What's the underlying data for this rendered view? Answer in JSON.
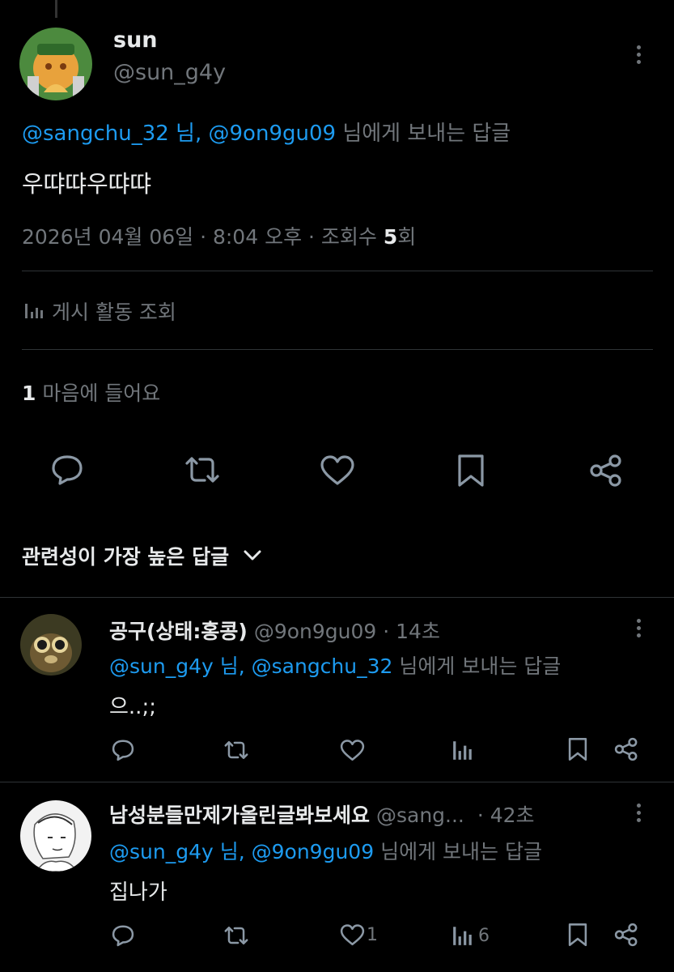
{
  "post": {
    "author_name": "sun",
    "author_handle": "@sun_g4y",
    "reply_mentions": "@sangchu_32 님, @9on9gu09",
    "reply_suffix": "님에게 보내는 답글",
    "text": "우땨땨우땨땨",
    "date_time": "2026년 04월 06일 · 8:04 오후 · 조회수 ",
    "view_count": "5",
    "view_unit": "회",
    "activity_label": "게시 활동 조회",
    "likes_count": "1",
    "likes_label": "마음에 들어요"
  },
  "actions": {
    "icons": [
      "reply-icon",
      "repost-icon",
      "like-icon",
      "bookmark-icon",
      "share-icon"
    ]
  },
  "sort": {
    "label": "관련성이 가장 높은 답글"
  },
  "replies": [
    {
      "name": "공구(상태:홍콩)",
      "handle": "@9on9gu09",
      "time": "· 14초",
      "mentions": "@sun_g4y 님, @sangchu_32",
      "suffix": "님에게 보내는 답글",
      "text": "으..;;",
      "like_count": "",
      "view_count": ""
    },
    {
      "name": "남성분들만제가올린글봐보세요",
      "handle": "@sang...",
      "time": "· 42초",
      "mentions": "@sun_g4y 님, @9on9gu09",
      "suffix": "님에게 보내는 답글",
      "text": "집나가",
      "like_count": "1",
      "view_count": "6"
    }
  ],
  "colors": {
    "background": "#000000",
    "text": "#e7e9ea",
    "secondary": "#71767b",
    "accent": "#1d9bf0",
    "divider": "#2f3336"
  }
}
